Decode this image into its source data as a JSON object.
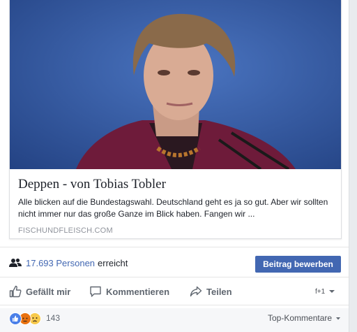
{
  "link_preview": {
    "title": "Deppen - von Tobias Tobler",
    "description": "Alle blicken auf die Bundestagswahl. Deutschland geht es ja so gut. Aber wir sollten nicht immer nur das große Ganze im Blick haben. Fangen wir ...",
    "domain": "FISCHUNDFLEISCH.COM",
    "image_alt": "photo-of-politician-speaking"
  },
  "reach": {
    "count": "17.693 Personen",
    "suffix": "erreicht",
    "promote_label": "Beitrag bewerben"
  },
  "actions": {
    "like": "Gefällt mir",
    "comment": "Kommentieren",
    "share": "Teilen",
    "audience": "f+1"
  },
  "reactions": {
    "count": "143",
    "sort_label": "Top-Kommentare",
    "types": [
      "like",
      "angry",
      "sad"
    ]
  },
  "colors": {
    "brand": "#4267b2",
    "muted": "#90949c"
  }
}
